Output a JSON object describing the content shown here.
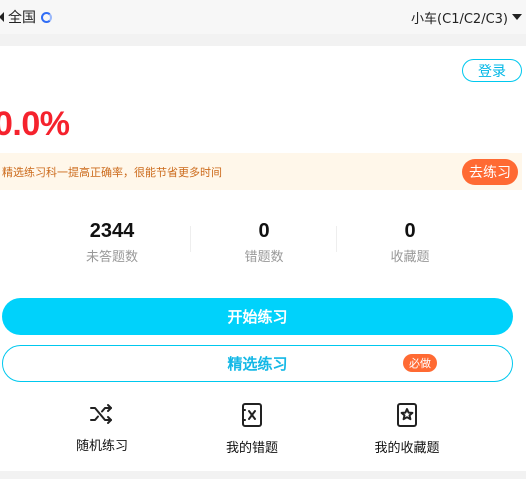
{
  "topbar": {
    "region": "全国",
    "vehicle": "小车(C1/C2/C3)"
  },
  "login_label": "登录",
  "accuracy": {
    "value": "0.0%"
  },
  "tip": {
    "text": "精选练习科一提高正确率，很能节省更多时间",
    "button_label": "去练习"
  },
  "stats": [
    {
      "value": "2344",
      "label": "未答题数"
    },
    {
      "value": "0",
      "label": "错题数"
    },
    {
      "value": "0",
      "label": "收藏题"
    }
  ],
  "actions": {
    "start_label": "开始练习",
    "select_label": "精选练习",
    "select_badge": "必做"
  },
  "tools": [
    {
      "label": "随机练习",
      "icon": "shuffle-icon"
    },
    {
      "label": "我的错题",
      "icon": "wrong-note-icon"
    },
    {
      "label": "我的收藏题",
      "icon": "star-bookmark-icon"
    }
  ],
  "colors": {
    "accent": "#00d2fb",
    "alert": "#ff6a33",
    "rate": "#f5222d",
    "tip_bg": "#fff7ea"
  }
}
